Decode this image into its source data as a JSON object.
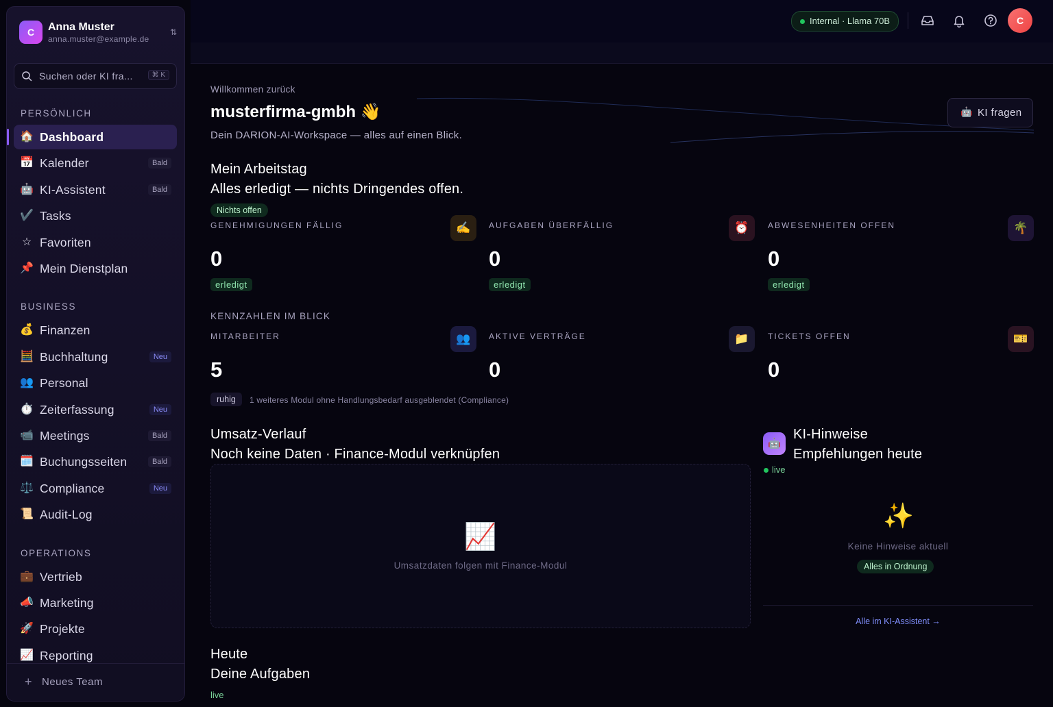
{
  "account": {
    "initial": "C",
    "name": "Anna Muster",
    "email": "anna.muster@example.de",
    "switch_icon": "⇅"
  },
  "search": {
    "placeholder": "Suchen oder KI fra...",
    "shortcut": "⌘ K"
  },
  "sidebar": {
    "sections": [
      {
        "title": "PERSÖNLICH",
        "items": [
          {
            "icon": "🏠",
            "label": "Dashboard",
            "active": true
          },
          {
            "icon": "📅",
            "label": "Kalender",
            "badge": "Bald"
          },
          {
            "icon": "🤖",
            "label": "KI-Assistent",
            "badge": "Bald"
          },
          {
            "icon": "✔️",
            "label": "Tasks"
          },
          {
            "icon": "☆",
            "label": "Favoriten"
          },
          {
            "icon": "📌",
            "label": "Mein Dienstplan"
          }
        ]
      },
      {
        "title": "BUSINESS",
        "items": [
          {
            "icon": "💰",
            "label": "Finanzen"
          },
          {
            "icon": "🧮",
            "label": "Buchhaltung",
            "badge": "Neu"
          },
          {
            "icon": "👥",
            "label": "Personal"
          },
          {
            "icon": "⏱️",
            "label": "Zeiterfassung",
            "badge": "Neu"
          },
          {
            "icon": "📹",
            "label": "Meetings",
            "badge": "Bald"
          },
          {
            "icon": "🗓️",
            "label": "Buchungsseiten",
            "badge": "Bald"
          },
          {
            "icon": "⚖️",
            "label": "Compliance",
            "badge": "Neu"
          },
          {
            "icon": "📜",
            "label": "Audit-Log"
          }
        ]
      },
      {
        "title": "OPERATIONS",
        "items": [
          {
            "icon": "💼",
            "label": "Vertrieb"
          },
          {
            "icon": "📣",
            "label": "Marketing"
          },
          {
            "icon": "🚀",
            "label": "Projekte"
          },
          {
            "icon": "📈",
            "label": "Reporting"
          }
        ]
      }
    ],
    "footer_label": "Neues Team"
  },
  "topbar": {
    "model_label": "Internal · Llama 70B",
    "user_initial": "C",
    "icons": [
      "inbox-icon",
      "bell-icon",
      "help-icon"
    ]
  },
  "header": {
    "welcome": "Willkommen zurück",
    "workspace": "musterfirma-gmbh 👋",
    "tagline": "Dein DARION-AI-Workspace — alles auf einen Blick.",
    "ask_ai_icon": "🤖",
    "ask_ai_label": "KI fragen"
  },
  "workday": {
    "title": "Mein Arbeitstag",
    "subtitle": "Alles erledigt — nichts Dringendes offen.",
    "status": "Nichts offen",
    "cards": [
      {
        "caption": "GENEHMIGUNGEN FÄLLIG",
        "icon": "✍️",
        "icon_bg": "#2a1f12",
        "value": "0",
        "status": "erledigt"
      },
      {
        "caption": "AUFGABEN ÜBERFÄLLIG",
        "icon": "⏰",
        "icon_bg": "#2a1220",
        "value": "0",
        "status": "erledigt"
      },
      {
        "caption": "ABWESENHEITEN OFFEN",
        "icon": "🌴",
        "icon_bg": "#1e1434",
        "value": "0",
        "status": "erledigt"
      }
    ]
  },
  "kpis": {
    "title": "KENNZAHLEN IM BLICK",
    "cards": [
      {
        "caption": "MITARBEITER",
        "icon": "👥",
        "icon_bg": "#1b1a3e",
        "value": "5"
      },
      {
        "caption": "AKTIVE VERTRÄGE",
        "icon": "📁",
        "icon_bg": "#1a1830",
        "value": "0"
      },
      {
        "caption": "TICKETS OFFEN",
        "icon": "🎫",
        "icon_bg": "#2a1322",
        "value": "0"
      }
    ],
    "status": "ruhig",
    "hint": "1 weiteres Modul ohne Handlungsbedarf ausgeblendet (Compliance)"
  },
  "revenue": {
    "title": "Umsatz-Verlauf",
    "subtitle": "Noch keine Daten · Finance-Modul verknüpfen",
    "empty_icon": "📈",
    "empty_text": "Umsatzdaten folgen mit Finance-Modul"
  },
  "ai_hints": {
    "icon": "🤖",
    "title": "KI-Hinweise",
    "subtitle": "Empfehlungen heute",
    "live": "live",
    "sparkle": "✨",
    "empty_text": "Keine Hinweise aktuell",
    "ok": "Alles in Ordnung",
    "link": "Alle im KI-Assistent →"
  },
  "today": {
    "title": "Heute",
    "subtitle": "Deine Aufgaben",
    "live": "live"
  }
}
